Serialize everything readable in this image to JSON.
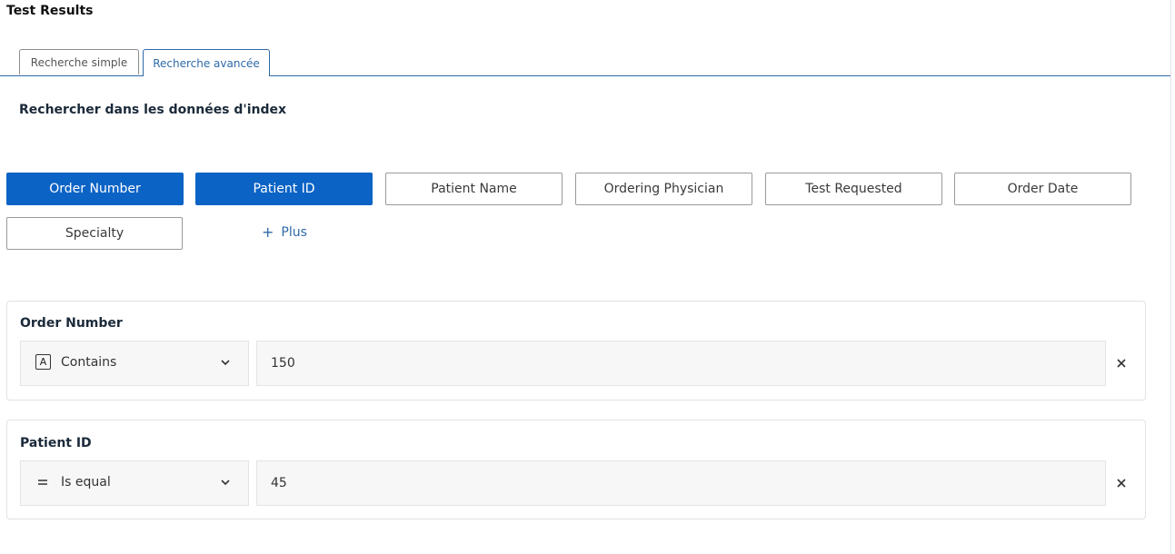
{
  "page": {
    "title": "Test Results"
  },
  "tabs": [
    {
      "label": "Recherche simple",
      "active": false
    },
    {
      "label": "Recherche avancée",
      "active": true
    }
  ],
  "section": {
    "title": "Rechercher dans les données d'index"
  },
  "fields": [
    {
      "label": "Order Number",
      "selected": true
    },
    {
      "label": "Patient ID",
      "selected": true
    },
    {
      "label": "Patient Name",
      "selected": false
    },
    {
      "label": "Ordering Physician",
      "selected": false
    },
    {
      "label": "Test Requested",
      "selected": false
    },
    {
      "label": "Order Date",
      "selected": false
    },
    {
      "label": "Specialty",
      "selected": false
    }
  ],
  "more": {
    "label": "Plus",
    "icon": "plus-icon"
  },
  "filters": [
    {
      "title": "Order Number",
      "operator": "Contains",
      "operator_icon": "text-type-icon",
      "value": "150"
    },
    {
      "title": "Patient ID",
      "operator": "Is equal",
      "operator_icon": "equals-icon",
      "value": "45"
    }
  ],
  "colors": {
    "accent": "#0b63c5",
    "link": "#2e6aa8"
  }
}
